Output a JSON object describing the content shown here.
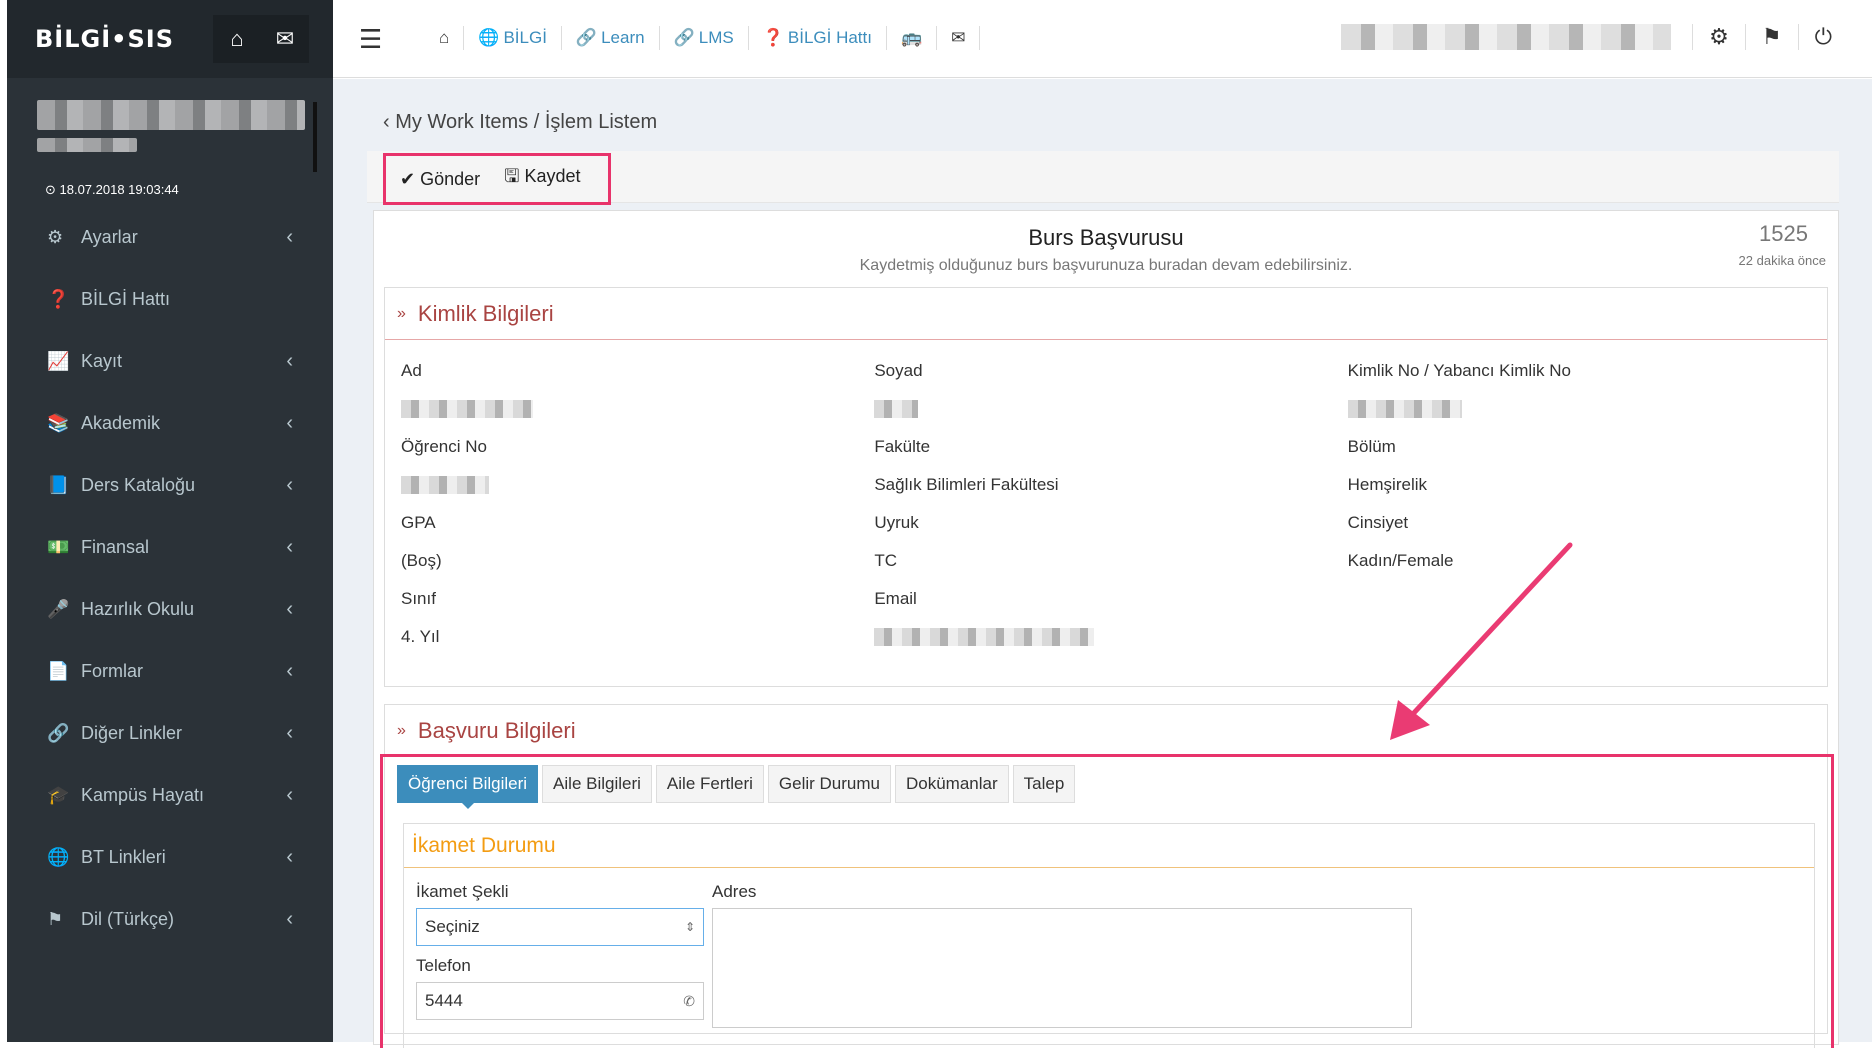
{
  "app": {
    "logo": "BİLGİ•SIS"
  },
  "user": {
    "timestamp": "⊙ 18.07.2018 19:03:44"
  },
  "sidebar": {
    "items": [
      {
        "icon": "⚙",
        "label": "Ayarlar"
      },
      {
        "icon": "❓",
        "label": "BİLGİ Hattı"
      },
      {
        "icon": "📈",
        "label": "Kayıt"
      },
      {
        "icon": "📚",
        "label": "Akademik"
      },
      {
        "icon": "📘",
        "label": "Ders Kataloğu"
      },
      {
        "icon": "💵",
        "label": "Finansal"
      },
      {
        "icon": "🎤",
        "label": "Hazırlık Okulu"
      },
      {
        "icon": "📄",
        "label": "Formlar"
      },
      {
        "icon": "🔗",
        "label": "Diğer Linkler"
      },
      {
        "icon": "🎓",
        "label": "Kampüs Hayatı"
      },
      {
        "icon": "🌐",
        "label": "BT Linkleri"
      },
      {
        "icon": "⚑",
        "label": "Dil (Türkçe)"
      }
    ]
  },
  "topbar": {
    "links": [
      {
        "icon": "🌐",
        "label": "BİLGİ"
      },
      {
        "icon": "🔗",
        "label": "Learn"
      },
      {
        "icon": "🔗",
        "label": "LMS"
      },
      {
        "icon": "❓",
        "label": "BİLGİ Hattı"
      }
    ]
  },
  "breadcrumb": "‹ My Work Items / İşlem Listem",
  "actions": {
    "send": "✔ Gönder",
    "save": "🖫 Kaydet"
  },
  "form": {
    "title": "Burs Başvurusu",
    "subtitle": "Kaydetmiş olduğunuz burs başvurunuza buradan devam edebilirsiniz.",
    "id": "1525",
    "ago": "22 dakika önce"
  },
  "identity": {
    "heading": "Kimlik Bilgileri",
    "labels": {
      "ad": "Ad",
      "soyad": "Soyad",
      "kimlik": "Kimlik No / Yabancı Kimlik No",
      "ogrenci_no": "Öğrenci No",
      "fakulte": "Fakülte",
      "bolum": "Bölüm",
      "gpa": "GPA",
      "uyruk": "Uyruk",
      "cinsiyet": "Cinsiyet",
      "sinif": "Sınıf",
      "email": "Email"
    },
    "values": {
      "fakulte": "Sağlık Bilimleri Fakültesi",
      "bolum": "Hemşirelik",
      "gpa": "(Boş)",
      "uyruk": "TC",
      "cinsiyet": "Kadın/Female",
      "sinif": "4. Yıl"
    }
  },
  "application": {
    "heading": "Başvuru Bilgileri",
    "tabs": [
      "Öğrenci Bilgileri",
      "Aile Bilgileri",
      "Aile Fertleri",
      "Gelir Durumu",
      "Dokümanlar",
      "Talep"
    ],
    "residence": {
      "heading": "İkamet Durumu",
      "ikamet_label": "İkamet Şekli",
      "ikamet_value": "Seçiniz",
      "adres_label": "Adres",
      "telefon_label": "Telefon",
      "telefon_value": "5444"
    }
  }
}
